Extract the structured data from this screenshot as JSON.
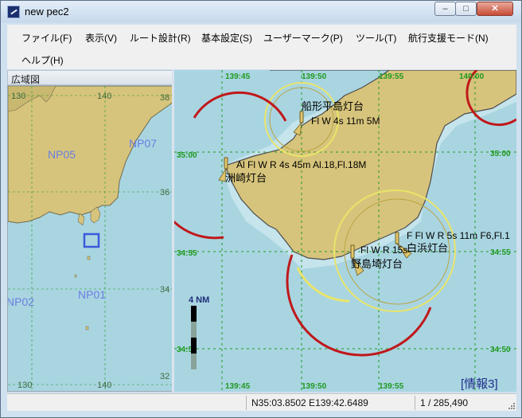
{
  "window": {
    "title": "new pec2",
    "minimize": "–",
    "maximize": "□",
    "close": "✕"
  },
  "menu": {
    "items": [
      "ファイル(F)",
      "表示(V)",
      "ルート設計(R)",
      "基本設定(S)",
      "ユーザーマーク(P)",
      "ツール(T)",
      "航行支援モード(N)",
      "ヘルプ(H)"
    ]
  },
  "overview": {
    "title": "広域図",
    "zones": [
      "NP05",
      "NP07",
      "NP01",
      "NP02"
    ],
    "lon_labels": [
      "130",
      "140",
      "130",
      "140"
    ],
    "lat_labels": [
      "38",
      "36",
      "34",
      "32"
    ]
  },
  "chart": {
    "lon_labels": [
      "139:45",
      "139:50",
      "139:55",
      "140:00"
    ],
    "lat_labels": [
      "35:00",
      "34:55",
      "34:50"
    ],
    "lights": [
      {
        "name": "船形平島灯台",
        "char": "Fl W 4s 11m 5M"
      },
      {
        "name": "洲崎灯台",
        "char": "Al Fl W R 4s 45m Al.18,Fl.18M"
      },
      {
        "name": "野島埼灯台",
        "char": "Fl W R 15s"
      },
      {
        "name": "白浜灯台",
        "char": "F Fl W R 5s 11m F6,Fl.1"
      }
    ],
    "scale_label": "4 NM",
    "info_tag": "[情報3]"
  },
  "status": {
    "coords": "N35:03.8502 E139:42.6489",
    "scale": "1 / 285,490"
  },
  "colors": {
    "sea": "#a9d5e1",
    "land": "#d7c47c",
    "grid": "#1f9a1f",
    "sector_red": "#c0181a",
    "sector_yellow": "#e9e46a",
    "label_blue": "#6a7fe0"
  }
}
